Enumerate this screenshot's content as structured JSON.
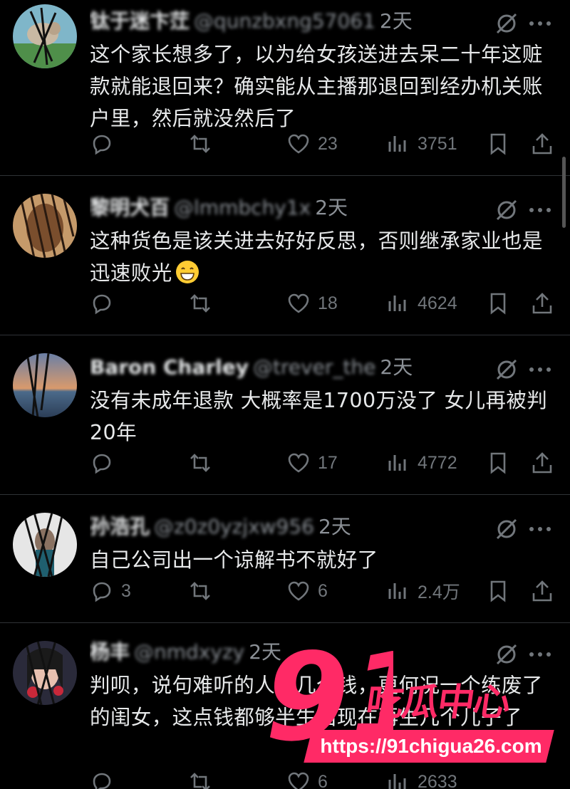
{
  "posts": [
    {
      "name": "钛于迷卞茳",
      "handle": "@qunzbxng57061",
      "time": "2天",
      "text": "这个家长想多了，以为给女孩送进去呆二十年这赃款就能退回来？确实能从主播那退回到经办机关账户里，然后就没然后了",
      "emoji": false,
      "replies": "",
      "retweets": "",
      "likes": "23",
      "views": "3751"
    },
    {
      "name": "黎明犬百",
      "handle": "@lmmbchy1x",
      "time": "2天",
      "text": "这种货色是该关进去好好反思，否则继承家业也是迅速败光",
      "emoji": true,
      "replies": "",
      "retweets": "",
      "likes": "18",
      "views": "4624"
    },
    {
      "name": "Baron Charley",
      "handle": "@trever_the",
      "time": "2天",
      "text": "没有未成年退款 大概率是1700万没了 女儿再被判20年",
      "emoji": false,
      "replies": "",
      "retweets": "",
      "likes": "17",
      "views": "4772"
    },
    {
      "name": "孙浩孔",
      "handle": "@z0z0yzjxw956",
      "time": "2天",
      "text": "自己公司出一个谅解书不就好了",
      "emoji": false,
      "replies": "3",
      "retweets": "",
      "likes": "6",
      "views": "2.4万"
    },
    {
      "name": "杨丰",
      "handle": "@nmdxyzy",
      "time": "2天",
      "text": "判呗，说句难听的人命几个钱，更何况一个练废了的闺女，这点钱都够半生出现在再生几个儿子了",
      "emoji": false,
      "replies": "",
      "retweets": "",
      "likes": "6",
      "views": "2633"
    }
  ],
  "icons": {
    "reply": "reply-icon",
    "retweet": "retweet-icon",
    "like": "heart-icon",
    "views": "views-icon",
    "bookmark": "bookmark-icon",
    "share": "share-icon",
    "grok": "grok-icon",
    "more": "more-icon"
  },
  "watermark": {
    "number": "91",
    "brand": "吃瓜中心",
    "url": "https://91chigua26.com"
  },
  "colors": {
    "background": "#000000",
    "text": "#e7e9ea",
    "muted": "#71767b",
    "divider": "#2f3336",
    "watermark": "#ff2a66"
  }
}
